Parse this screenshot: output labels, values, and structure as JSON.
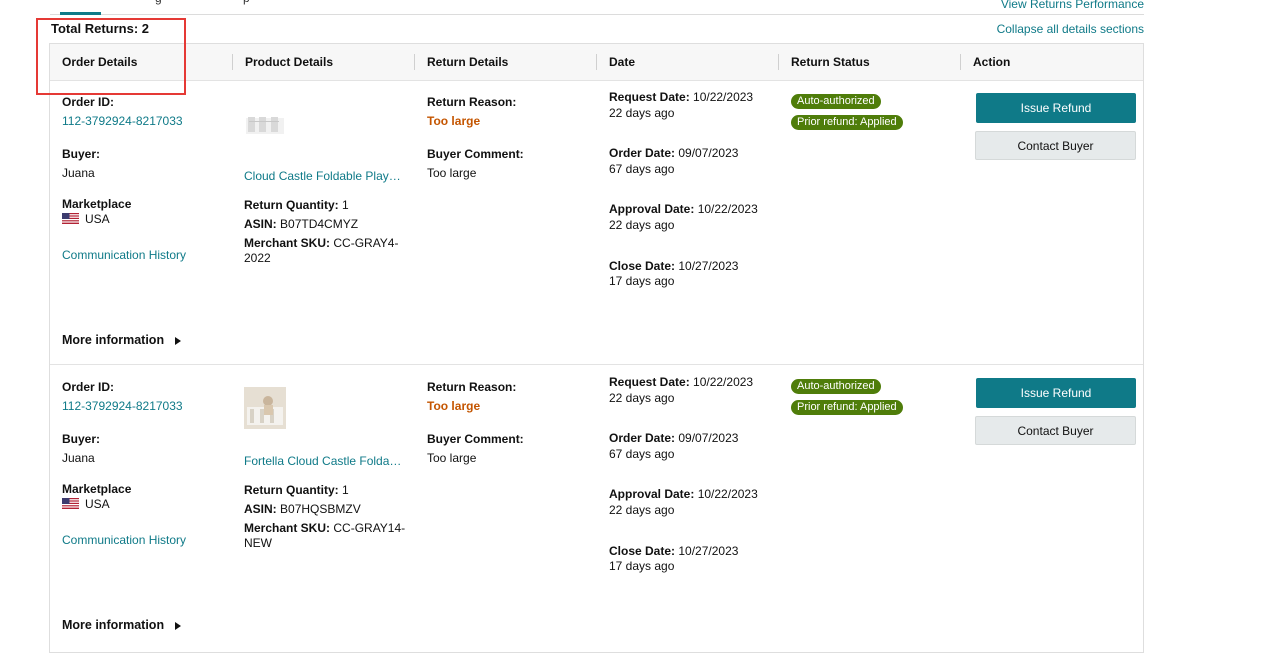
{
  "header": {
    "tab_fragment_1": "g",
    "tab_fragment_2": "p",
    "view_performance_link": "View Returns Performance",
    "total_returns": "Total Returns: 2",
    "collapse_link": "Collapse all details sections"
  },
  "columns": [
    "Order Details",
    "Product Details",
    "Return Details",
    "Date",
    "Return Status",
    "Action"
  ],
  "labels": {
    "order_id": "Order ID:",
    "buyer": "Buyer:",
    "marketplace": "Marketplace",
    "communication_history": "Communication History",
    "return_quantity": "Return Quantity:",
    "asin": "ASIN:",
    "merchant_sku": "Merchant SKU:",
    "return_reason": "Return Reason:",
    "buyer_comment": "Buyer Comment:",
    "request_date": "Request Date:",
    "order_date": "Order Date:",
    "approval_date": "Approval Date:",
    "close_date": "Close Date:",
    "more_information": "More information",
    "issue_refund": "Issue Refund",
    "contact_buyer": "Contact Buyer"
  },
  "returns": [
    {
      "order_id": "112-3792924-8217033",
      "buyer": "Juana",
      "marketplace": "USA",
      "product_name": "Cloud Castle Foldable Playpen for Babies and Toddlers",
      "return_quantity": "1",
      "asin": "B07TD4CMYZ",
      "merchant_sku_line1": "CC-GRAY4-",
      "merchant_sku_line2": "2022",
      "return_reason": "Too large",
      "buyer_comment": "Too large",
      "request_date": "10/22/2023",
      "request_ago": "22 days ago",
      "order_date": "09/07/2023",
      "order_ago": "67 days ago",
      "approval_date": "10/22/2023",
      "approval_ago": "22 days ago",
      "close_date": "10/27/2023",
      "close_ago": "17 days ago",
      "status_badges": [
        "Auto-authorized",
        "Prior refund: Applied"
      ]
    },
    {
      "order_id": "112-3792924-8217033",
      "buyer": "Juana",
      "marketplace": "USA",
      "product_name": "Fortella Cloud Castle Foldable Playpen for Babies",
      "return_quantity": "1",
      "asin": "B07HQSBMZV",
      "merchant_sku_line1": "CC-GRAY14-",
      "merchant_sku_line2": "NEW",
      "return_reason": "Too large",
      "buyer_comment": "Too large",
      "request_date": "10/22/2023",
      "request_ago": "22 days ago",
      "order_date": "09/07/2023",
      "order_ago": "67 days ago",
      "approval_date": "10/22/2023",
      "approval_ago": "22 days ago",
      "close_date": "10/27/2023",
      "close_ago": "17 days ago",
      "status_badges": [
        "Auto-authorized",
        "Prior refund: Applied"
      ]
    }
  ],
  "colors": {
    "accent": "#0f7a88",
    "reason": "#c45500",
    "badge": "#4f7d0a",
    "highlight": "#e53935"
  }
}
